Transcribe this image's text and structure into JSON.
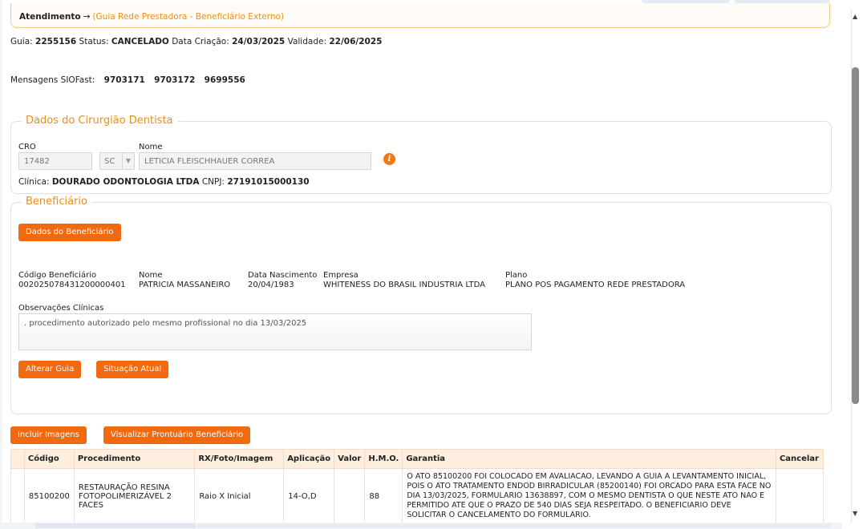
{
  "breadcrumb": {
    "root": "Atendimento",
    "arrow": "→",
    "current": "(Guia Rede Prestadora - Beneficiário Externo)"
  },
  "guia": {
    "guia_label": "Guia:",
    "guia_value": "2255156",
    "status_label": "Status:",
    "status_value": "CANCELADO",
    "criacao_label": "Data Criação:",
    "criacao_value": "24/03/2025",
    "validade_label": "Validade:",
    "validade_value": "22/06/2025"
  },
  "mensagens": {
    "label": "Mensagens SIOFast:",
    "values": [
      "9703171",
      "9703172",
      "9699556"
    ]
  },
  "dentista": {
    "legend": "Dados do Cirurgião Dentista",
    "cro_label": "CRO",
    "cro_value": "17482",
    "uf_value": "SC",
    "nome_label": "Nome",
    "nome_value": "LETICIA FLEISCHHAUER CORREA",
    "clinica_label": "Clínica:",
    "clinica_value": "DOURADO ODONTOLOGIA LTDA",
    "cnpj_label": "CNPJ:",
    "cnpj_value": "27191015000130",
    "info_glyph": "i"
  },
  "beneficiario": {
    "legend": "Beneficiário",
    "dados_button": "Dados do Beneficiário",
    "codigo_label": "Código Beneficiário",
    "codigo_value": "00202507843120000040​1",
    "nome_label": "Nome",
    "nome_value": "PATRICIA MASSANEIRO",
    "nasc_label": "Data Nascimento",
    "nasc_value": "20/04/1983",
    "empresa_label": "Empresa",
    "empresa_value": "WHITENESS DO BRASIL INDUSTRIA LTDA",
    "plano_label": "Plano",
    "plano_value": "PLANO POS PAGAMENTO REDE PRESTADORA",
    "obs_label": "Observações Clínicas",
    "obs_value": ". procedimento autorizado pelo mesmo profissional no dia 13/03/2025",
    "alterar_button": "Alterar Guia",
    "situacao_button": "Situação Atual"
  },
  "actions": {
    "incluir_imagens": "Incluir Imagens",
    "visualizar_prontuario": "Visualizar Prontuário Beneficiário"
  },
  "table": {
    "headers": [
      "Código",
      "Procedimento",
      "RX/Foto/Imagem",
      "Aplicação",
      "Valor",
      "H.M.O.",
      "Garantia",
      "Cancelar"
    ],
    "rows": [
      {
        "codigo": "85100200",
        "procedimento": "RESTAURAÇÃO RESINA FOTOPOLIMERIZÁVEL 2 FACES",
        "rx": "Raio X Inicial",
        "aplicacao": "14-O,D",
        "valor": "",
        "hmo": "88",
        "garantia": "O ATO 85100200 FOI COLOCADO EM AVALIACAO, LEVANDO A GUIA A LEVANTAMENTO INICIAL, POIS O ATO TRATAMENTO ENDOD BIRRADICULAR (85200140) FOI ORCADO PARA ESTA FACE NO DIA 13/03/2025, FORMULARIO 13638897, COM O MESMO DENTISTA O QUE NESTE ATO NAO E PERMITIDO ATE QUE O PRAZO DE 540 DIAS SEJA RESPEITADO. O BENEFICIARIO DEVE SOLICITAR O CANCELAMENTO DO FORMULARIO.",
        "cancelar": ""
      }
    ]
  },
  "colors": {
    "accent": "#f26a10",
    "legend": "#e8901a",
    "header_bg": "#fdeee0"
  }
}
